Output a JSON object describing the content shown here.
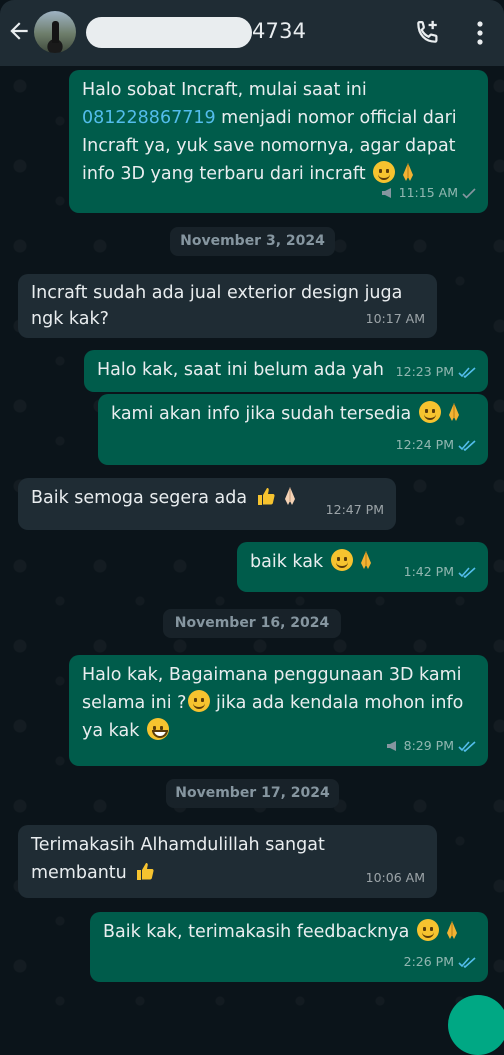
{
  "header": {
    "contact_suffix": "4734",
    "icons": [
      "back-arrow-icon",
      "avatar",
      "add-call-icon",
      "more-vert-icon"
    ]
  },
  "messages": [
    {
      "dir": "out",
      "text_before_link": "Halo sobat Incraft, mulai saat ini\n",
      "link": "081228867719",
      "text_after_link": " menjadi nomor official dari\nIncraft ya, yuk save nomornya, agar dapat\ninfo 3D yang terbaru dari incraft",
      "emoji": [
        "smile",
        "pray"
      ],
      "time": "11:15 AM",
      "status": "sent-broadcast"
    },
    {
      "dir": "date",
      "text": "November 3, 2024"
    },
    {
      "dir": "in",
      "text": "Incraft sudah ada jual exterior design juga\nngk kak?",
      "time": "10:17 AM"
    },
    {
      "dir": "out",
      "text": "Halo kak, saat ini belum ada yah",
      "time": "12:23 PM",
      "status": "read"
    },
    {
      "dir": "out",
      "text": "kami akan info jika sudah tersedia",
      "emoji": [
        "smile",
        "pray"
      ],
      "time": "12:24 PM",
      "status": "read"
    },
    {
      "dir": "in",
      "text": "Baik semoga segera ada",
      "emoji": [
        "thumbs-up",
        "pray"
      ],
      "time": "12:47 PM"
    },
    {
      "dir": "out",
      "text": "baik kak",
      "emoji": [
        "smile",
        "pray"
      ],
      "time": "1:42 PM",
      "status": "read"
    },
    {
      "dir": "date",
      "text": "November 16, 2024"
    },
    {
      "dir": "out",
      "text": "Halo kak, Bagaimana penggunaan 3D kami\nselama ini ?",
      "text2": " jika ada kendala mohon info\nya kak",
      "emoji": [
        "smile",
        "grin"
      ],
      "time": "8:29 PM",
      "status": "read-broadcast"
    },
    {
      "dir": "date",
      "text": "November 17, 2024"
    },
    {
      "dir": "in",
      "text": "Terimakasih Alhamdulillah sangat\nmembantu",
      "emoji": [
        "thumbs-up"
      ],
      "time": "10:06 AM"
    },
    {
      "dir": "out",
      "text": "Baik kak, terimakasih feedbacknya",
      "emoji": [
        "relieved",
        "pray"
      ],
      "time": "2:26 PM",
      "status": "read"
    }
  ],
  "colors": {
    "background": "#0b141a",
    "header": "#1f2c34",
    "outgoing": "#005c4b",
    "incoming": "#1f2c34",
    "link": "#53bdeb",
    "read_ticks": "#53bdeb",
    "fab": "#00a884"
  }
}
